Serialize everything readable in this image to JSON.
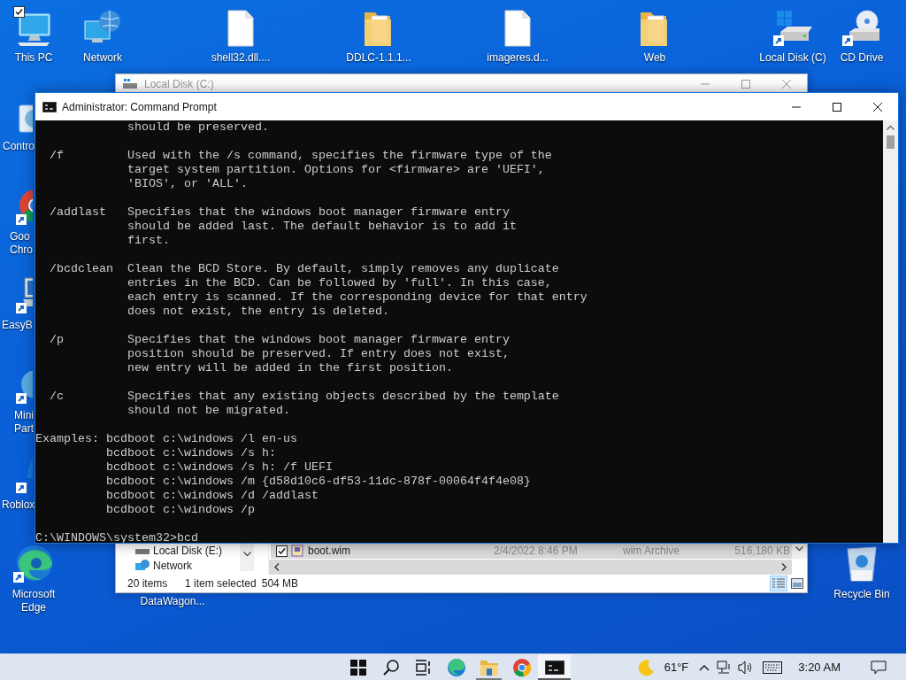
{
  "desktop_icons": [
    {
      "kind": "pc",
      "label": [
        "This PC"
      ],
      "checked": true
    },
    {
      "kind": "network",
      "label": [
        "Network"
      ],
      "checked": false
    },
    {
      "kind": "file",
      "label": [
        "shell32.dll...."
      ],
      "checked": false
    },
    {
      "kind": "folder",
      "label": [
        "DDLC-1.1.1..."
      ],
      "checked": false
    },
    {
      "kind": "file",
      "label": [
        "imageres.d..."
      ],
      "checked": false
    },
    {
      "kind": "folder",
      "label": [
        "Web"
      ],
      "checked": false
    },
    {
      "kind": "drive",
      "label": [
        "Local Disk (C)"
      ],
      "checked": false
    },
    {
      "kind": "cd",
      "label": [
        "CD Drive"
      ],
      "checked": false
    },
    {
      "kind": "control",
      "label": [
        "Contro"
      ],
      "checked": false
    },
    {
      "kind": "chrome",
      "label": [
        "Goo",
        "Chro"
      ],
      "checked": false
    },
    {
      "kind": "easybcd",
      "label": [
        "EasyB"
      ],
      "checked": false
    },
    {
      "kind": "minitool",
      "label": [
        "Mini",
        "Part"
      ],
      "checked": false
    },
    {
      "kind": "roblox",
      "label": [
        "Roblox"
      ],
      "checked": false
    },
    {
      "kind": "edge",
      "label": [
        "Microsoft",
        "Edge"
      ],
      "checked": false
    },
    {
      "kind": "hidden",
      "label": [
        "DataWagon..."
      ],
      "checked": false
    },
    {
      "kind": "recycle",
      "label": [
        "Recycle Bin"
      ],
      "checked": false
    }
  ],
  "explorer": {
    "title": "Local Disk (C:)",
    "nav_items": [
      {
        "label": "Local Disk (E:)",
        "kind": "drive"
      },
      {
        "label": "Network",
        "kind": "network"
      }
    ],
    "files": [
      {
        "name": "boot.wim",
        "date": "2/4/2022 8:46 PM",
        "type": "wim Archive",
        "size": "516,180 KB",
        "selected": true,
        "checked": true
      }
    ],
    "status": {
      "count": "20 items",
      "selection": "1 item selected",
      "size": "504 MB"
    },
    "views": [
      {
        "kind": "details",
        "selected": true
      },
      {
        "kind": "tiles",
        "selected": false
      }
    ]
  },
  "terminal": {
    "title": "Administrator: Command Prompt",
    "blocks": [
      [
        "             should be preserved."
      ],
      [
        "  /f         Used with the /s command, specifies the firmware type of the",
        "             target system partition. Options for <firmware> are 'UEFI',",
        "             'BIOS', or 'ALL'."
      ],
      [
        "  /addlast   Specifies that the windows boot manager firmware entry",
        "             should be added last. The default behavior is to add it",
        "             first."
      ],
      [
        "  /bcdclean  Clean the BCD Store. By default, simply removes any duplicate",
        "             entries in the BCD. Can be followed by 'full'. In this case,",
        "             each entry is scanned. If the corresponding device for that entry",
        "             does not exist, the entry is deleted."
      ],
      [
        "  /p         Specifies that the windows boot manager firmware entry",
        "             position should be preserved. If entry does not exist,",
        "             new entry will be added in the first position."
      ],
      [
        "  /c         Specifies that any existing objects described by the template",
        "             should not be migrated."
      ],
      [
        "Examples: bcdboot c:\\windows /l en-us",
        "          bcdboot c:\\windows /s h:",
        "          bcdboot c:\\windows /s h: /f UEFI",
        "          bcdboot c:\\windows /m {d58d10c6-df53-11dc-878f-00064f4f4e08}",
        "          bcdboot c:\\windows /d /addlast",
        "          bcdboot c:\\windows /p"
      ],
      [
        "C:\\WINDOWS\\system32>bcd"
      ]
    ]
  },
  "taskbar": {
    "apps": [
      {
        "kind": "start",
        "running": false,
        "active": false
      },
      {
        "kind": "search",
        "running": false,
        "active": false
      },
      {
        "kind": "taskview",
        "running": false,
        "active": false
      },
      {
        "kind": "edge",
        "running": false,
        "active": false
      },
      {
        "kind": "folder",
        "running": true,
        "active": false
      },
      {
        "kind": "chrome",
        "running": false,
        "active": false
      },
      {
        "kind": "cmd",
        "running": true,
        "active": true
      }
    ],
    "temperature": "61°F",
    "clock": "3:20 AM"
  }
}
